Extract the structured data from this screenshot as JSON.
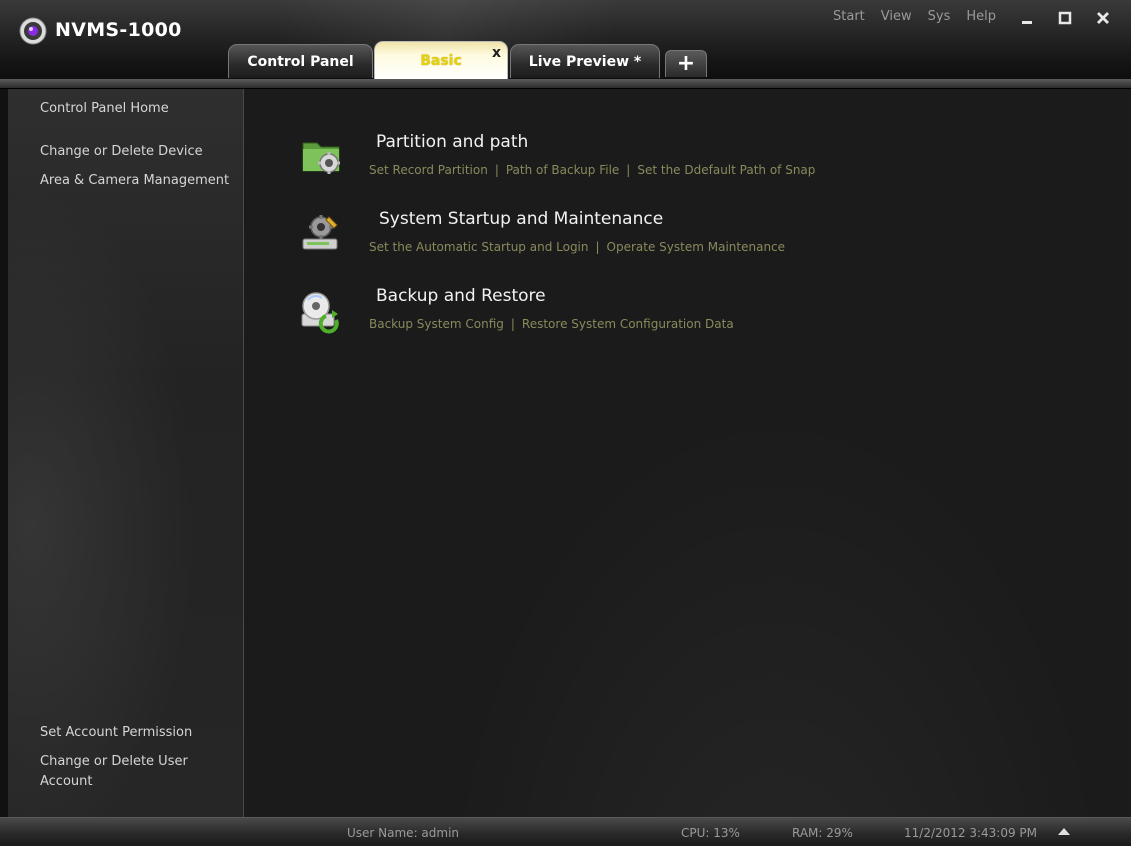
{
  "app": {
    "title": "NVMS-1000"
  },
  "menu": {
    "items": [
      "Start",
      "View",
      "Sys",
      "Help"
    ]
  },
  "window_controls": {
    "minimize": "_",
    "maximize": "□",
    "close": "✕"
  },
  "tabs": [
    {
      "label": "Control Panel",
      "active": false
    },
    {
      "label": "Basic",
      "active": true,
      "close": "x"
    },
    {
      "label": "Live Preview *",
      "active": false
    },
    {
      "label": "+",
      "active": false
    }
  ],
  "sidebar": {
    "items": [
      "Control Panel Home",
      "Change or Delete Device",
      "Area & Camera Management",
      "Set Account Permission",
      "Change or Delete User Account"
    ]
  },
  "sections": [
    {
      "title": "Partition and path",
      "icon": "folder-gear-icon",
      "links": [
        "Set Record Partition",
        "Path of Backup File",
        "Set the Ddefault Path of Snap"
      ]
    },
    {
      "title": "System Startup and Maintenance",
      "icon": "tools-gear-icon",
      "links": [
        "Set the Automatic Startup and Login",
        "Operate System Maintenance"
      ]
    },
    {
      "title": "Backup and Restore",
      "icon": "disc-restore-icon",
      "links": [
        "Backup System Config",
        "Restore System Configuration Data"
      ]
    }
  ],
  "link_separator": "|",
  "status": {
    "user": "User Name: admin",
    "cpu": "CPU: 13%",
    "ram": "RAM: 29%",
    "datetime": "11/2/2012 3:43:09 PM"
  },
  "colors": {
    "accent_tab_label": "#e6d10e",
    "link_color": "#8a8a5c",
    "background": "#1b1b1b"
  }
}
